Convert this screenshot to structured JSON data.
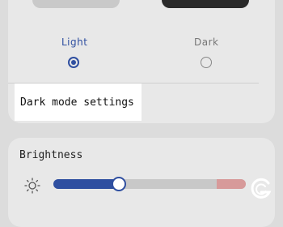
{
  "theme": {
    "options": [
      {
        "label": "Light",
        "selected": true
      },
      {
        "label": "Dark",
        "selected": false
      }
    ],
    "dark_mode_settings_label": "Dark mode settings"
  },
  "brightness": {
    "title": "Brightness",
    "level_fraction": 0.34,
    "icons": {
      "left": "sun-icon"
    }
  },
  "colors": {
    "accent": "#2f4fa0",
    "background": "#dcdcdc",
    "card": "#e8e8e8"
  }
}
